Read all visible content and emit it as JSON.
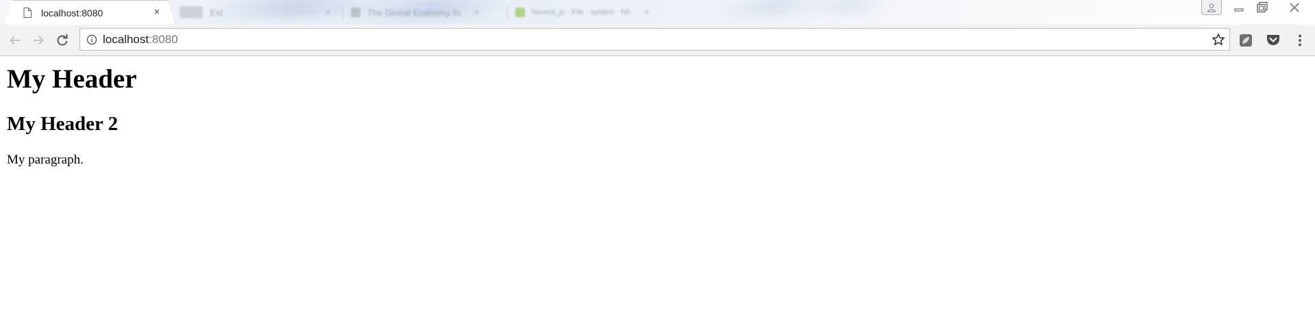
{
  "browser": {
    "active_tab": {
      "title": "localhost:8080",
      "close_glyph": "×",
      "icon": "page-icon"
    },
    "background_tabs": [
      {
        "title": "Ext",
        "color": "#c9ced8"
      },
      {
        "title": "The Global Economy fo",
        "color": "#b9bec6"
      },
      {
        "title": "Novela_js · File · system · Nh",
        "color": "#a6d07a"
      }
    ],
    "window_controls": {
      "minimize": "minimize-icon",
      "maximize": "restore-icon",
      "close": "close-icon"
    },
    "omnibox": {
      "host": "localhost",
      "port": ":8080"
    },
    "toolbar_icons": [
      "back-arrow-icon",
      "forward-arrow-icon",
      "reload-icon",
      "info-icon",
      "star-icon",
      "extension-icon",
      "pocket-icon",
      "kebab-menu-icon"
    ]
  },
  "page": {
    "heading1": "My Header",
    "heading2": "My Header 2",
    "paragraph": "My paragraph."
  },
  "colors": {
    "toolbar_bg": "#f2f2f2",
    "pocket": "#4a4a4a"
  }
}
